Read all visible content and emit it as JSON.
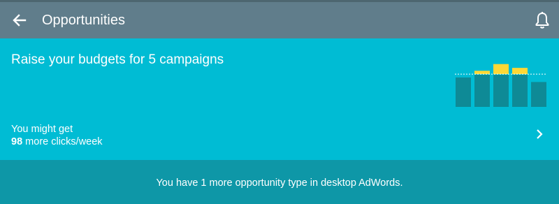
{
  "app_bar": {
    "title": "Opportunities",
    "back_icon": "arrow-left-icon",
    "notification_icon": "bell-icon",
    "background": "#607d8b"
  },
  "opportunity_card": {
    "headline": "Raise your budgets for 5 campaigns",
    "estimate_prefix": "You might get",
    "estimate_value": "98",
    "estimate_suffix": "more clicks/week",
    "chevron_icon": "chevron-right-icon",
    "background": "#00bcd4",
    "illustration": {
      "bar_color": "#0e8a96",
      "gain_color": "#fdd835",
      "bars": [
        {
          "base": 0.78,
          "gain": 0.0
        },
        {
          "base": 0.85,
          "gain": 0.15
        },
        {
          "base": 0.85,
          "gain": 0.45
        },
        {
          "base": 0.85,
          "gain": 0.28
        },
        {
          "base": 0.66,
          "gain": 0.0
        }
      ]
    }
  },
  "footer": {
    "message": "You have 1 more opportunity type in desktop AdWords.",
    "background": "#0e97a7"
  }
}
